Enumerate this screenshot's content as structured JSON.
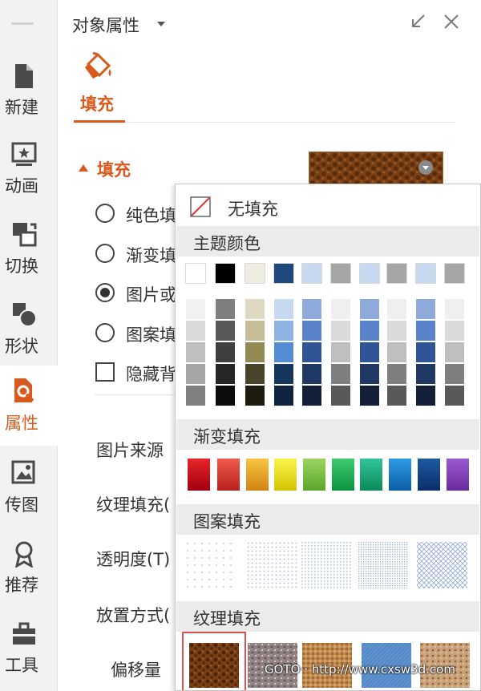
{
  "sidebar": {
    "items": [
      {
        "label": "新建",
        "icon": "new-file-icon"
      },
      {
        "label": "动画",
        "icon": "animation-icon"
      },
      {
        "label": "切换",
        "icon": "transition-icon"
      },
      {
        "label": "形状",
        "icon": "shape-icon"
      },
      {
        "label": "属性",
        "icon": "property-icon",
        "active": true
      },
      {
        "label": "传图",
        "icon": "image-upload-icon"
      },
      {
        "label": "推荐",
        "icon": "recommend-icon"
      },
      {
        "label": "工具",
        "icon": "toolbox-icon"
      }
    ]
  },
  "panel": {
    "title": "对象属性",
    "tab_label": "填充",
    "accent": "#d95a1e"
  },
  "fill": {
    "section_title": "填充",
    "options": [
      {
        "label": "纯色填充",
        "type": "radio",
        "checked": false
      },
      {
        "label": "渐变填充",
        "type": "radio",
        "checked": false
      },
      {
        "label": "图片或纹理填充",
        "type": "radio",
        "checked": true
      },
      {
        "label": "图案填充",
        "type": "radio",
        "checked": false
      },
      {
        "label": "隐藏背景图形",
        "type": "checkbox",
        "checked": false
      }
    ],
    "props": {
      "source": "图片来源",
      "texture": "纹理填充(",
      "transparency": "透明度(T)",
      "placement": "放置方式(",
      "offset": "偏移量"
    }
  },
  "popup": {
    "no_fill": "无填充",
    "theme_colors_title": "主题颜色",
    "gradient_title": "渐变填充",
    "pattern_title": "图案填充",
    "texture_title": "纹理填充",
    "theme_top": [
      "#ffffff",
      "#000000",
      "#eeece1",
      "#1f497d",
      "#c6d9f0",
      "#a6a6a6",
      "#c6d9f0",
      "#a6a6a6",
      "#c6d9f0",
      "#a6a6a6"
    ],
    "theme_shades": [
      [
        "#f2f2f2",
        "#d9d9d9",
        "#bfbfbf",
        "#a6a6a6",
        "#808080"
      ],
      [
        "#7f7f7f",
        "#595959",
        "#3f3f3f",
        "#262626",
        "#0c0c0c"
      ],
      [
        "#ddd9c3",
        "#c4bd97",
        "#938953",
        "#494429",
        "#1d1b10"
      ],
      [
        "#c6d9f0",
        "#8db3e2",
        "#548dd4",
        "#17365d",
        "#0f243e"
      ],
      [
        "#8eaadb",
        "#5b83cc",
        "#2f5597",
        "#1f3864",
        "#131f38"
      ],
      [
        "#efefef",
        "#d9d9d9",
        "#bfbfbf",
        "#7f7f7f",
        "#595959"
      ],
      [
        "#8eaadb",
        "#5b83cc",
        "#2f5597",
        "#1f3864",
        "#131f38"
      ],
      [
        "#efefef",
        "#d9d9d9",
        "#bfbfbf",
        "#7f7f7f",
        "#595959"
      ],
      [
        "#8eaadb",
        "#5b83cc",
        "#2f5597",
        "#1f3864",
        "#131f38"
      ],
      [
        "#efefef",
        "#d9d9d9",
        "#bfbfbf",
        "#7f7f7f",
        "#595959"
      ]
    ],
    "gradients": [
      [
        "#e8252b",
        "#a00010"
      ],
      [
        "#f05a4a",
        "#b8201e"
      ],
      [
        "#f7c542",
        "#d1830f"
      ],
      [
        "#fbf44f",
        "#d6c300"
      ],
      [
        "#9bd561",
        "#5aa52a"
      ],
      [
        "#3ecb6f",
        "#0c9340"
      ],
      [
        "#33c49b",
        "#0b8a5a"
      ],
      [
        "#2f9be6",
        "#0a5ea8"
      ],
      [
        "#1d5aa0",
        "#0b2d6a"
      ],
      [
        "#9b5ad0",
        "#6a2a9c"
      ]
    ],
    "textures": [
      {
        "name": "brown-leather-texture",
        "base": "#7a4014",
        "spot": "#4a2208",
        "selected": true
      },
      {
        "name": "granite-texture",
        "base": "#8e7f80",
        "spot": "#c8bcbc"
      },
      {
        "name": "woven-canvas-texture",
        "base": "#c0894e",
        "spot": "#8a5a2a"
      },
      {
        "name": "blue-denim-texture",
        "base": "#5e93cf",
        "spot": "#4a7fbf"
      },
      {
        "name": "sand-cork-texture",
        "base": "#c9a27a",
        "spot": "#8a6040"
      }
    ]
  },
  "watermark": "GOTO·· http://www.cxsw3d.com"
}
